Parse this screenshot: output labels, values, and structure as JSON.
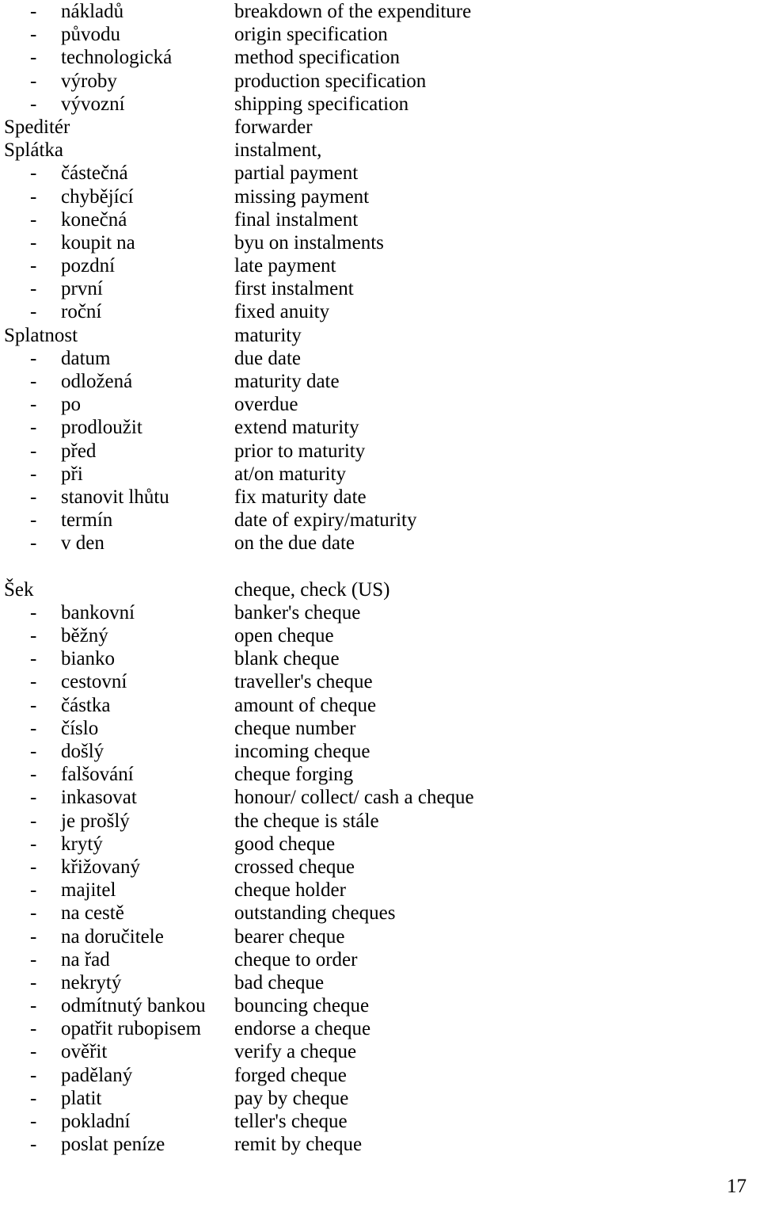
{
  "document": {
    "page_number": "17",
    "bullet_glyph": "-",
    "entries": [
      {
        "type": "sub",
        "term": "nákladů",
        "translation": "breakdown of the expenditure"
      },
      {
        "type": "sub",
        "term": "původu",
        "translation": "origin specification"
      },
      {
        "type": "sub",
        "term": "technologická",
        "translation": "method specification"
      },
      {
        "type": "sub",
        "term": "výroby",
        "translation": "production specification"
      },
      {
        "type": "sub",
        "term": "vývozní",
        "translation": "shipping specification"
      },
      {
        "type": "main",
        "term": "Speditér",
        "translation": "forwarder"
      },
      {
        "type": "main",
        "term": "Splátka",
        "translation": "instalment,"
      },
      {
        "type": "sub",
        "term": "částečná",
        "translation": "partial payment"
      },
      {
        "type": "sub",
        "term": "chybějící",
        "translation": "missing payment"
      },
      {
        "type": "sub",
        "term": "konečná",
        "translation": "final instalment"
      },
      {
        "type": "sub",
        "term": "koupit na",
        "translation": "byu on instalments"
      },
      {
        "type": "sub",
        "term": "pozdní",
        "translation": "late payment"
      },
      {
        "type": "sub",
        "term": "první",
        "translation": "first instalment"
      },
      {
        "type": "sub",
        "term": "roční",
        "translation": "fixed anuity"
      },
      {
        "type": "main",
        "term": "Splatnost",
        "translation": "maturity"
      },
      {
        "type": "sub",
        "term": "datum",
        "translation": "due date"
      },
      {
        "type": "sub",
        "term": "odložená",
        "translation": "maturity date"
      },
      {
        "type": "sub",
        "term": "po",
        "translation": "overdue"
      },
      {
        "type": "sub",
        "term": "prodloužit",
        "translation": "extend maturity"
      },
      {
        "type": "sub",
        "term": "před",
        "translation": "prior to maturity"
      },
      {
        "type": "sub",
        "term": "při",
        "translation": "at/on maturity"
      },
      {
        "type": "sub",
        "term": "stanovit lhůtu",
        "translation": "fix maturity date"
      },
      {
        "type": "sub",
        "term": "termín",
        "translation": "date of expiry/maturity"
      },
      {
        "type": "sub",
        "term": "v den",
        "translation": "on the due date"
      },
      {
        "type": "spacer",
        "term": "",
        "translation": ""
      },
      {
        "type": "main",
        "term": "Šek",
        "translation": "cheque, check (US)"
      },
      {
        "type": "sub",
        "term": "bankovní",
        "translation": "banker's cheque"
      },
      {
        "type": "sub",
        "term": "běžný",
        "translation": "open cheque"
      },
      {
        "type": "sub",
        "term": "bianko",
        "translation": "blank cheque"
      },
      {
        "type": "sub",
        "term": "cestovní",
        "translation": "traveller's cheque"
      },
      {
        "type": "sub",
        "term": "částka",
        "translation": "amount of cheque"
      },
      {
        "type": "sub",
        "term": "číslo",
        "translation": "cheque number"
      },
      {
        "type": "sub",
        "term": "došlý",
        "translation": "incoming cheque"
      },
      {
        "type": "sub",
        "term": "falšování",
        "translation": "cheque forging"
      },
      {
        "type": "sub",
        "term": "inkasovat",
        "translation": "honour/ collect/ cash a cheque"
      },
      {
        "type": "sub",
        "term": "je prošlý",
        "translation": "the cheque is stále"
      },
      {
        "type": "sub",
        "term": "krytý",
        "translation": "good cheque"
      },
      {
        "type": "sub",
        "term": "křižovaný",
        "translation": "crossed cheque"
      },
      {
        "type": "sub",
        "term": "majitel",
        "translation": "cheque holder"
      },
      {
        "type": "sub",
        "term": "na cestě",
        "translation": "outstanding cheques"
      },
      {
        "type": "sub",
        "term": "na doručitele",
        "translation": "bearer cheque"
      },
      {
        "type": "sub",
        "term": "na řad",
        "translation": "cheque to order"
      },
      {
        "type": "sub",
        "term": "nekrytý",
        "translation": "bad cheque"
      },
      {
        "type": "sub",
        "term": "odmítnutý bankou",
        "translation": "bouncing cheque"
      },
      {
        "type": "sub",
        "term": "opatřit rubopisem",
        "translation": "endorse a cheque"
      },
      {
        "type": "sub",
        "term": "ověřit",
        "translation": "verify a cheque"
      },
      {
        "type": "sub",
        "term": "padělaný",
        "translation": "forged cheque"
      },
      {
        "type": "sub",
        "term": "platit",
        "translation": "pay by cheque"
      },
      {
        "type": "sub",
        "term": "pokladní",
        "translation": "teller's cheque"
      },
      {
        "type": "sub",
        "term": "poslat peníze",
        "translation": "remit by cheque"
      }
    ]
  }
}
